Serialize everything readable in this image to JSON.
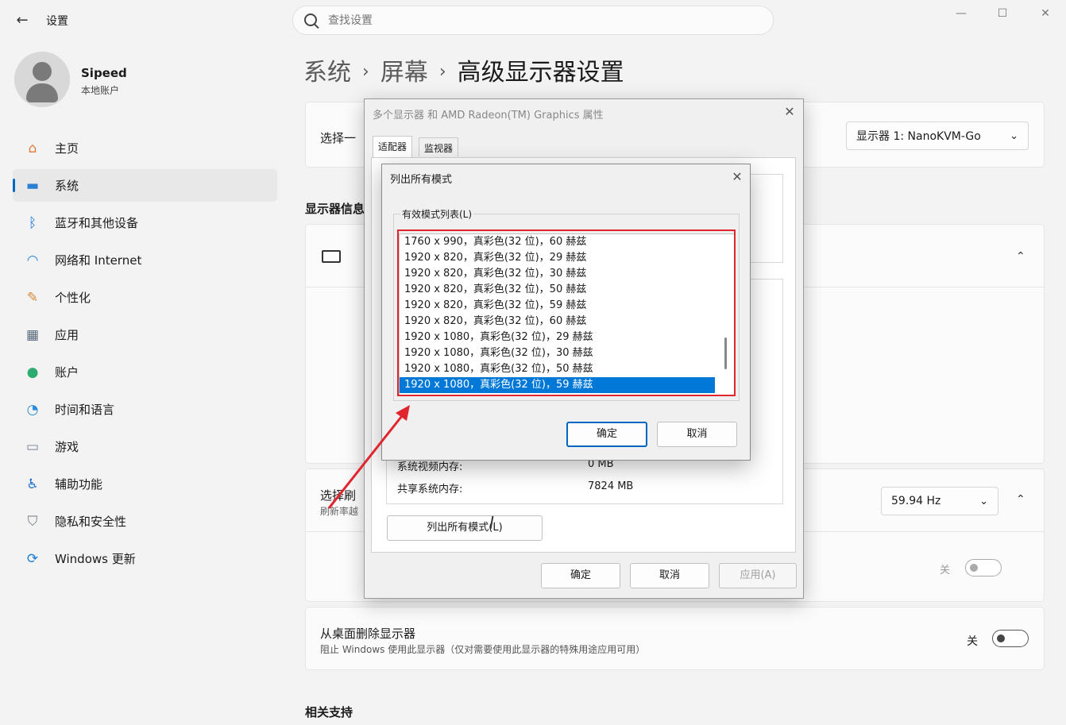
{
  "app": {
    "title": "设置",
    "back_glyph": "←",
    "win_min": "—",
    "win_max": "☐",
    "win_close": "✕"
  },
  "search": {
    "placeholder": "查找设置"
  },
  "profile": {
    "name": "Sipeed",
    "account_type": "本地账户"
  },
  "nav": {
    "items": [
      {
        "label": "主页",
        "icon": "home-icon",
        "glyph": "⌂",
        "color": "#e07a3b"
      },
      {
        "label": "系统",
        "icon": "system-icon",
        "glyph": "▬",
        "color": "#2a7fd4"
      },
      {
        "label": "蓝牙和其他设备",
        "icon": "bluetooth-icon",
        "glyph": "ᛒ",
        "color": "#1a73d9"
      },
      {
        "label": "网络和 Internet",
        "icon": "wifi-icon",
        "glyph": "◠",
        "color": "#1e88e5"
      },
      {
        "label": "个性化",
        "icon": "brush-icon",
        "glyph": "✎",
        "color": "#d8893a"
      },
      {
        "label": "应用",
        "icon": "apps-icon",
        "glyph": "▦",
        "color": "#5a6b7d"
      },
      {
        "label": "账户",
        "icon": "account-icon",
        "glyph": "●",
        "color": "#2eab6f"
      },
      {
        "label": "时间和语言",
        "icon": "globe-clock-icon",
        "glyph": "◔",
        "color": "#2a8be0"
      },
      {
        "label": "游戏",
        "icon": "gamepad-icon",
        "glyph": "▭",
        "color": "#7a8593"
      },
      {
        "label": "辅助功能",
        "icon": "accessibility-icon",
        "glyph": "♿",
        "color": "#1f6fd0"
      },
      {
        "label": "隐私和安全性",
        "icon": "shield-icon",
        "glyph": "⛉",
        "color": "#707a84"
      },
      {
        "label": "Windows 更新",
        "icon": "update-icon",
        "glyph": "⟳",
        "color": "#1c7fd6"
      }
    ]
  },
  "breadcrumb": {
    "part1": "系统",
    "part2": "屏幕",
    "current": "高级显示器设置",
    "sep": "›"
  },
  "main": {
    "select_display_label": "选择一",
    "display_dropdown": "显示器 1: NanoKVM-Go",
    "display_info_title": "显示器信息",
    "refresh_label": "选择刷",
    "refresh_sub": "刷新率越",
    "refresh_value": "59.94 Hz",
    "toggle1_state": "关",
    "remove_title": "从桌面删除显示器",
    "remove_desc": "阻止 Windows 使用此显示器（仅对需要使用此显示器的特殊用途应用可用）",
    "remove_state": "关",
    "related_title": "相关支持",
    "chevron_up": "⌃",
    "chevron_down": "⌄"
  },
  "props_dialog": {
    "title": "多个显示器 和 AMD Radeon(TM) Graphics 属性",
    "tabs": [
      "适配器",
      "监视器"
    ],
    "system_video_mem_label": "系统视频内存:",
    "system_video_mem_value": "0 MB",
    "shared_mem_label": "共享系统内存:",
    "shared_mem_value": "7824 MB",
    "list_all_modes_btn": "列出所有模式(L)",
    "ok": "确定",
    "cancel": "取消",
    "apply": "应用(A)"
  },
  "modes_dialog": {
    "title": "列出所有模式",
    "group_label": "有效模式列表(L)",
    "modes": [
      "1760 x 990，真彩色(32 位)，60 赫兹",
      "1920 x 820，真彩色(32 位)，29 赫兹",
      "1920 x 820，真彩色(32 位)，30 赫兹",
      "1920 x 820，真彩色(32 位)，50 赫兹",
      "1920 x 820，真彩色(32 位)，59 赫兹",
      "1920 x 820，真彩色(32 位)，60 赫兹",
      "1920 x 1080，真彩色(32 位)，29 赫兹",
      "1920 x 1080，真彩色(32 位)，30 赫兹",
      "1920 x 1080，真彩色(32 位)，50 赫兹",
      "1920 x 1080，真彩色(32 位)，59 赫兹"
    ],
    "selected_index": 9,
    "ok": "确定",
    "cancel": "取消"
  },
  "annotation": {
    "highlight_color": "#e0252e"
  }
}
